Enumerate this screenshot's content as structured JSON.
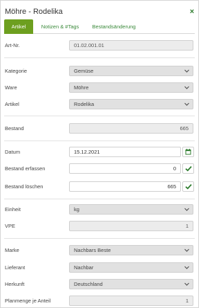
{
  "header": {
    "title": "Möhre - Rodelika",
    "close_label": "×"
  },
  "tabs": [
    {
      "label": "Artikel",
      "active": true
    },
    {
      "label": "Notizen & #Tags",
      "active": false
    },
    {
      "label": "Bestandsänderung",
      "active": false
    }
  ],
  "fields": {
    "art_nr": {
      "label": "Art-Nr.",
      "value": "01.02.001.01"
    },
    "kategorie": {
      "label": "Kategorie",
      "value": "Gemüse"
    },
    "ware": {
      "label": "Ware",
      "value": "Möhre"
    },
    "artikel": {
      "label": "Artikel",
      "value": "Rodelika"
    },
    "bestand": {
      "label": "Bestand",
      "value": "665"
    },
    "datum": {
      "label": "Datum",
      "value": "15.12.2021"
    },
    "bestand_erfassen": {
      "label": "Bestand erfassen",
      "value": "0"
    },
    "bestand_loeschen": {
      "label": "Bestand löschen",
      "value": "665"
    },
    "einheit": {
      "label": "Einheit",
      "value": "kg"
    },
    "vpe": {
      "label": "VPE",
      "value": "1"
    },
    "marke": {
      "label": "Marke",
      "value": "Nachbars Beste"
    },
    "lieferant": {
      "label": "Lieferant",
      "value": "Nachbar"
    },
    "herkunft": {
      "label": "Herkunft",
      "value": "Deutschland"
    },
    "planmenge": {
      "label": "Planmenge je Anteil",
      "value": "1"
    }
  },
  "icons": {
    "close": "close-icon",
    "dropdown": "chevron-down-icon",
    "calendar": "calendar-icon",
    "confirm": "checkmark-icon"
  },
  "colors": {
    "accent": "#6d9f1f",
    "accent_text": "#3b8a3b",
    "confirm_icon": "#2f7d2f"
  }
}
